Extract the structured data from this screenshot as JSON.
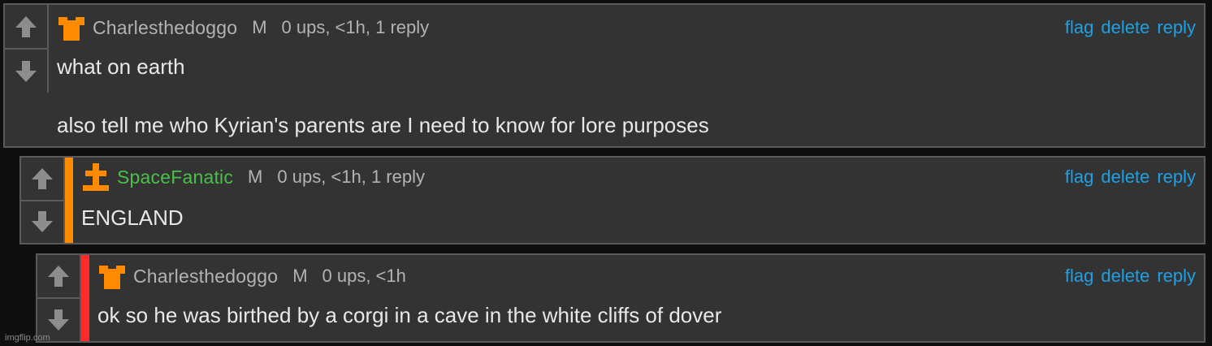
{
  "colors": {
    "background": "#0f0f0f",
    "panel": "#333333",
    "border": "#5a5a5a",
    "link": "#1fa0e4",
    "muted": "#b3b3b3",
    "green_user": "#4bbf4b",
    "orange_stripe": "#ff8a00",
    "red_stripe": "#ff2b2b",
    "badge_orange": "#ff8a00"
  },
  "actions": {
    "flag": "flag",
    "delete": "delete",
    "reply": "reply"
  },
  "comments": [
    {
      "username": "Charlesthedoggo",
      "role": "M",
      "stats": "0 ups, <1h, 1 reply",
      "lines": [
        "what on earth",
        "also tell me who Kyrian's parents are I need to know for lore purposes"
      ],
      "badge_icon": "shirt-badge-icon"
    },
    {
      "username": "SpaceFanatic",
      "role": "M",
      "stats": "0 ups, <1h, 1 reply",
      "lines": [
        "ENGLAND"
      ],
      "badge_icon": "cross-badge-icon"
    },
    {
      "username": "Charlesthedoggo",
      "role": "M",
      "stats": "0 ups, <1h",
      "lines": [
        "ok so he was birthed by a corgi in a cave in the white cliffs of dover"
      ],
      "badge_icon": "shirt-badge-icon"
    }
  ],
  "watermark": "imgflip.com"
}
